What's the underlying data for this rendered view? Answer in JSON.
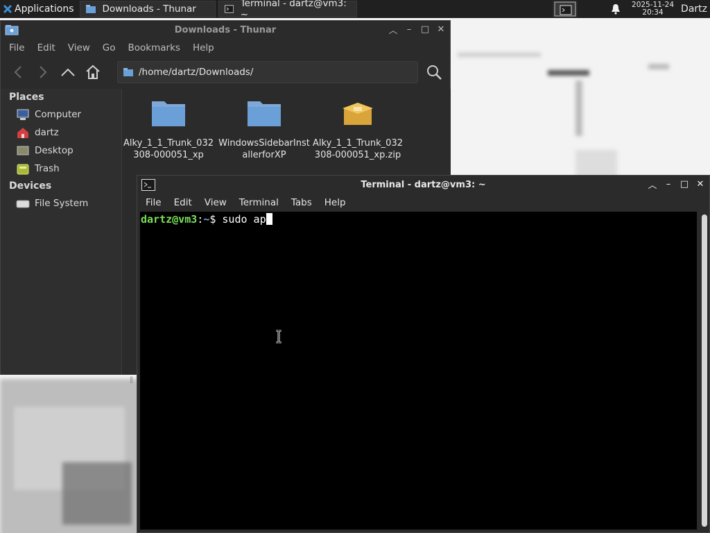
{
  "panel": {
    "applications_label": "Applications",
    "tasks": [
      {
        "label": "Downloads - Thunar",
        "icon": "folder-icon"
      },
      {
        "label": "Terminal - dartz@vm3: ~",
        "icon": "terminal-icon"
      }
    ],
    "clock_date": "2025-11-24",
    "clock_time": "20:34",
    "user": "Dartz"
  },
  "thunar": {
    "title": "Downloads - Thunar",
    "menu": [
      "File",
      "Edit",
      "View",
      "Go",
      "Bookmarks",
      "Help"
    ],
    "path": "/home/dartz/Downloads/",
    "sidebar": {
      "places_heading": "Places",
      "places": [
        "Computer",
        "dartz",
        "Desktop",
        "Trash"
      ],
      "devices_heading": "Devices",
      "devices": [
        "File System"
      ]
    },
    "files": [
      {
        "name": "Alky_1_1_Trunk_032308-000051_xp",
        "icon": "folder-icon"
      },
      {
        "name": "WindowsSidebarInstallerforXP",
        "icon": "folder-icon"
      },
      {
        "name": "Alky_1_1_Trunk_032308-000051_xp.zip",
        "icon": "archive-icon"
      }
    ]
  },
  "terminal": {
    "title": "Terminal - dartz@vm3: ~",
    "menu": [
      "File",
      "Edit",
      "View",
      "Terminal",
      "Tabs",
      "Help"
    ],
    "prompt_userhost": "dartz@vm3",
    "prompt_sep": ":",
    "prompt_cwd": "~",
    "prompt_symbol": "$",
    "command": "sudo ap"
  },
  "colors": {
    "prompt_user": "#7ae05a",
    "prompt_cwd": "#7aa6da",
    "folder_blue": "#6a9fd8",
    "panel_bg": "#202020"
  }
}
